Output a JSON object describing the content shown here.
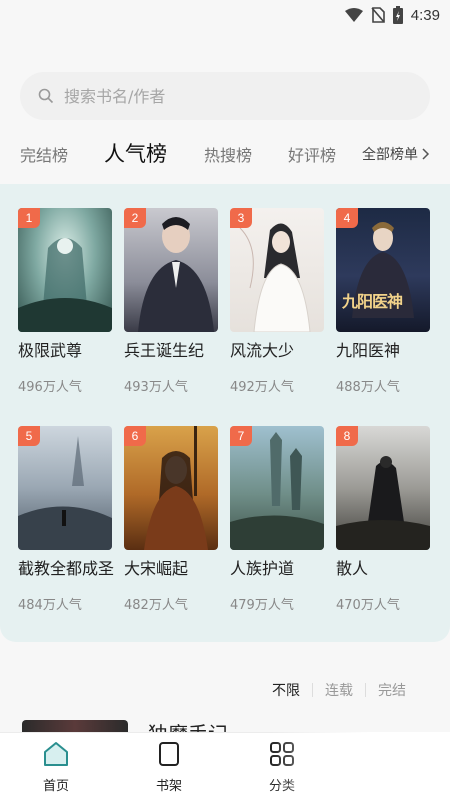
{
  "status_bar": {
    "time": "4:39",
    "icons": [
      "wifi-icon",
      "no-sim-icon",
      "battery-charging-icon"
    ]
  },
  "search": {
    "placeholder": "搜索书名/作者",
    "icon": "search-icon"
  },
  "tabs": [
    {
      "label": "完结榜",
      "active": false
    },
    {
      "label": "人气榜",
      "active": true
    },
    {
      "label": "热搜榜",
      "active": false
    },
    {
      "label": "好评榜",
      "active": false
    }
  ],
  "all_lists": {
    "label": "全部榜单",
    "icon": "chevron-right-icon"
  },
  "books": [
    {
      "rank": "1",
      "title": "极限武尊",
      "popularity": "496万人气"
    },
    {
      "rank": "2",
      "title": "兵王诞生纪",
      "popularity": "493万人气"
    },
    {
      "rank": "3",
      "title": "风流大少",
      "popularity": "492万人气"
    },
    {
      "rank": "4",
      "title": "九阳医神",
      "popularity": "488万人气",
      "cover_text": "九阳医神"
    },
    {
      "rank": "5",
      "title": "截教全都成圣",
      "popularity": "484万人气"
    },
    {
      "rank": "6",
      "title": "大宋崛起",
      "popularity": "482万人气"
    },
    {
      "rank": "7",
      "title": "人族护道",
      "popularity": "479万人气"
    },
    {
      "rank": "8",
      "title": "散人",
      "popularity": "470万人气"
    }
  ],
  "filter": [
    {
      "label": "不限",
      "active": true
    },
    {
      "label": "连载",
      "active": false
    },
    {
      "label": "完结",
      "active": false
    }
  ],
  "peek_book": {
    "title": "独魔手记"
  },
  "bottom_nav": [
    {
      "label": "首页",
      "icon": "home-icon",
      "active": true
    },
    {
      "label": "书架",
      "icon": "bookshelf-icon",
      "active": false
    },
    {
      "label": "分类",
      "icon": "category-grid-icon",
      "active": false
    }
  ],
  "colors": {
    "accent": "#f06a4a",
    "panel": "#e6f1f1",
    "home_icon": "#2a8f8f"
  }
}
